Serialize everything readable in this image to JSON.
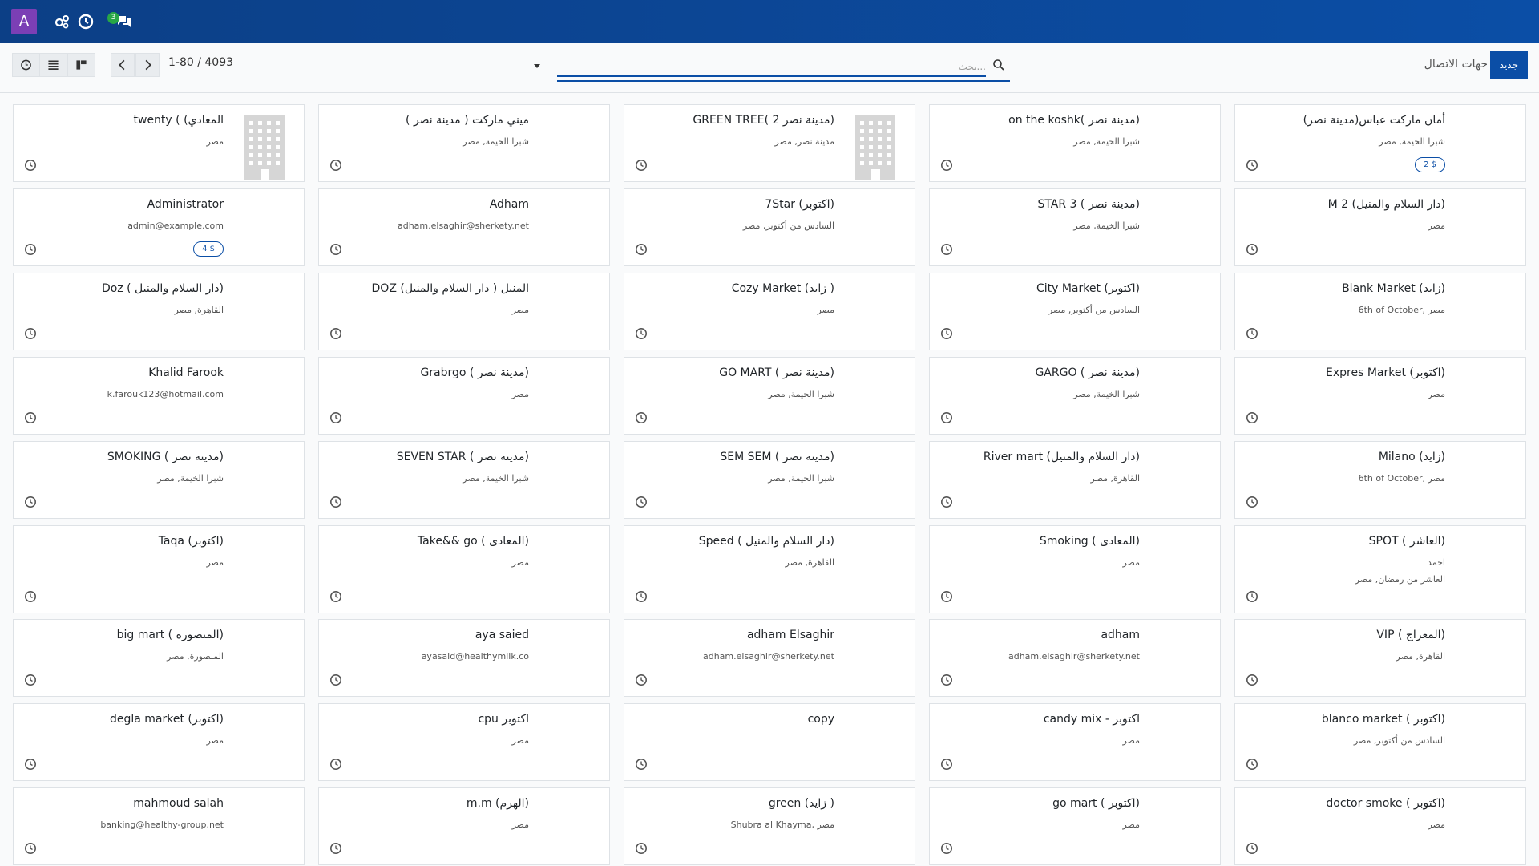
{
  "topbar": {
    "avatar_letter": "A",
    "chat_count": "3",
    "colors": {
      "bar": "#0b4ea6",
      "avatar": "#7b3fb5",
      "badge": "#28a745"
    }
  },
  "control": {
    "new_button": "جديد",
    "title": "جهات الاتصال",
    "search_placeholder": "بحث...",
    "pager_text": "1-80 / 4093"
  },
  "cards": [
    {
      "title": "أمان ماركت عباس(مدينة نصر)",
      "sub": "شبرا الخيمة, مصر",
      "badge": "2 $",
      "image": false
    },
    {
      "title": "on the koshk( مدينة نصر)",
      "sub": "شبرا الخيمة, مصر",
      "image": false
    },
    {
      "title": "GREEN TREE( 2 مدينة نصر)",
      "sub": "مدينة نصر, مصر",
      "image": true
    },
    {
      "title": "( ميني ماركت ( مدينة نصر",
      "sub": "شبرا الخيمة, مصر",
      "image": false
    },
    {
      "title": "twenty ( (المعادي",
      "sub": "مصر",
      "image": true
    },
    {
      "title": "M 2 (دار السلام والمنيل)",
      "sub": "مصر",
      "image": false
    },
    {
      "title": "STAR 3 ( مدينة نصر)",
      "sub": "شبرا الخيمة, مصر",
      "image": false
    },
    {
      "title": "7Star (اكتوبر)",
      "sub": "السادس من أكتوبر, مصر",
      "image": false
    },
    {
      "title": "Adham",
      "sub": "adham.elsaghir@sherkety.net",
      "image": false
    },
    {
      "title": "Administrator",
      "sub": "admin@example.com",
      "badge": "4 $",
      "image": false
    },
    {
      "title": "Blank Market (زايد)",
      "sub": "6th of October, مصر",
      "image": false
    },
    {
      "title": "City Market (اكتوبر)",
      "sub": "السادس من أكتوبر, مصر",
      "image": false
    },
    {
      "title": "Cozy Market (زايد )",
      "sub": "مصر",
      "image": false
    },
    {
      "title": "DOZ المنيل ( دار السلام والمنيل)",
      "sub": "مصر",
      "image": false
    },
    {
      "title": "Doz ( دار السلام والمنيل)",
      "sub": "القاهرة, مصر",
      "image": false
    },
    {
      "title": "Expres Market (اكتوبر)",
      "sub": "مصر",
      "image": false
    },
    {
      "title": "GARGO ( مدينة نصر)",
      "sub": "شبرا الخيمة, مصر",
      "image": false
    },
    {
      "title": "GO MART ( مدينة نصر)",
      "sub": "شبرا الخيمة, مصر",
      "image": false
    },
    {
      "title": "Grabrgo ( مدينة نصر)",
      "sub": "مصر",
      "image": false
    },
    {
      "title": "Khalid Farook",
      "sub": "k.farouk123@hotmail.com",
      "image": false
    },
    {
      "title": "Milano (زايد)",
      "sub": "6th of October, مصر",
      "image": false
    },
    {
      "title": "River mart (دار السلام والمنيل)",
      "sub": "القاهرة, مصر",
      "image": false
    },
    {
      "title": "SEM SEM ( مدينة نصر)",
      "sub": "شبرا الخيمة, مصر",
      "image": false
    },
    {
      "title": "SEVEN STAR ( مدينة نصر)",
      "sub": "شبرا الخيمة, مصر",
      "image": false
    },
    {
      "title": "SMOKING ( مدينة نصر)",
      "sub": "شبرا الخيمة, مصر",
      "image": false
    },
    {
      "title": "SPOT ( العاشر)",
      "sub": "احمد",
      "sub2": "العاشر من رمضان, مصر",
      "image": false
    },
    {
      "title": "Smoking ( المعادى)",
      "sub": "مصر",
      "image": false
    },
    {
      "title": "Speed ( دار السلام والمنيل)",
      "sub": "القاهرة, مصر",
      "image": false
    },
    {
      "title": "Take&& go ( المعادى)",
      "sub": "مصر",
      "image": false
    },
    {
      "title": "Taqa (اكتوبر)",
      "sub": "مصر",
      "image": false
    },
    {
      "title": "VIP ( المعراج)",
      "sub": "القاهرة, مصر",
      "image": false
    },
    {
      "title": "adham",
      "sub": "adham.elsaghir@sherkety.net",
      "image": false
    },
    {
      "title": "adham Elsaghir",
      "sub": "adham.elsaghir@sherkety.net",
      "image": false
    },
    {
      "title": "aya saied",
      "sub": "ayasaid@healthymilk.co",
      "image": false
    },
    {
      "title": "big mart ( المنصورة)",
      "sub": "المنصورة, مصر",
      "image": false
    },
    {
      "title": "blanco market ( اكتوبر)",
      "sub": "السادس من أكتوبر, مصر",
      "image": false
    },
    {
      "title": "candy mix - اكتوبر",
      "sub": "مصر",
      "image": false
    },
    {
      "title": "copy",
      "sub": "",
      "image": false
    },
    {
      "title": "cpu اكتوبر",
      "sub": "مصر",
      "image": false
    },
    {
      "title": "degla market (اكتوبر)",
      "sub": "مصر",
      "image": false
    },
    {
      "title": "doctor smoke ( اكتوبر)",
      "sub": "مصر",
      "image": false
    },
    {
      "title": "go mart ( اكتوبر)",
      "sub": "مصر",
      "image": false
    },
    {
      "title": "green (زايد )",
      "sub": "Shubra al Khayma, مصر",
      "image": false
    },
    {
      "title": "m.m (الهرم)",
      "sub": "مصر",
      "image": false
    },
    {
      "title": "mahmoud salah",
      "sub": "banking@healthy-group.net",
      "image": false
    }
  ]
}
